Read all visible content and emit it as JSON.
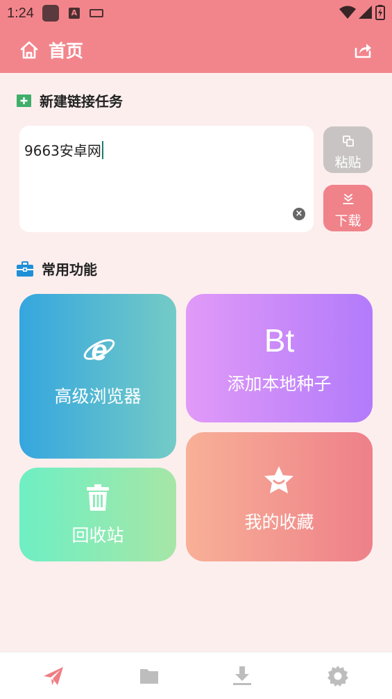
{
  "status_bar": {
    "time": "1:24",
    "icons": [
      "app-notification-icon",
      "text-a-icon",
      "keyboard-icon",
      "wifi-icon",
      "signal-icon",
      "battery-icon"
    ]
  },
  "app_bar": {
    "home_icon": "home-icon",
    "title": "首页",
    "share_icon": "share-icon"
  },
  "new_task": {
    "icon": "plus-box-icon",
    "heading": "新建链接任务",
    "input_value": "9663安卓网",
    "clear_icon": "close-circle-icon",
    "paste_label": "粘贴",
    "download_label": "下载"
  },
  "common_functions": {
    "icon": "toolbox-icon",
    "heading": "常用功能",
    "cards": {
      "browser": {
        "label": "高级浏览器",
        "icon": "ie-browser-icon"
      },
      "bt": {
        "label": "添加本地种子",
        "icon_text": "Bt"
      },
      "trash": {
        "label": "回收站",
        "icon": "trash-icon"
      },
      "favorites": {
        "label": "我的收藏",
        "icon": "star-badge-icon"
      }
    }
  },
  "bottom_nav": {
    "items": [
      "send-icon",
      "folder-icon",
      "download-icon",
      "settings-icon"
    ],
    "active_index": 0
  },
  "colors": {
    "primary": "#f2858c",
    "background": "#fdeeee",
    "nav_active": "#ee7e85",
    "nav_inactive": "#bdbdbd"
  }
}
